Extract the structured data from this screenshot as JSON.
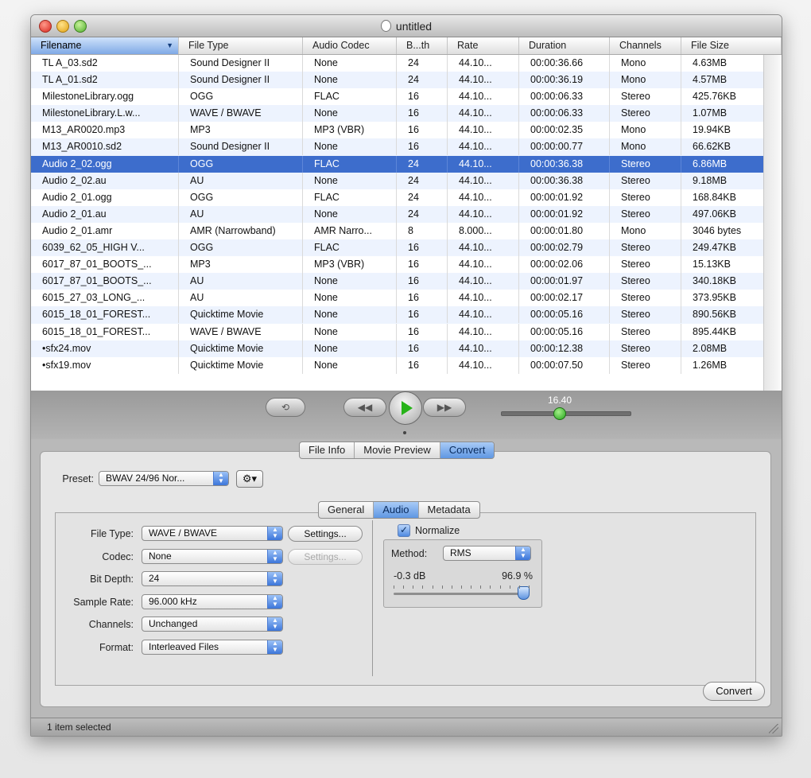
{
  "window": {
    "title": "untitled"
  },
  "table": {
    "columns": [
      "Filename",
      "File Type",
      "Audio Codec",
      "B...th",
      "Rate",
      "Duration",
      "Channels",
      "File Size"
    ],
    "rows": [
      [
        "TL A_03.sd2",
        "Sound Designer II",
        "None",
        "24",
        "44.10...",
        "00:00:36.66",
        "Mono",
        "4.63MB"
      ],
      [
        "TL A_01.sd2",
        "Sound Designer II",
        "None",
        "24",
        "44.10...",
        "00:00:36.19",
        "Mono",
        "4.57MB"
      ],
      [
        "MilestoneLibrary.ogg",
        "OGG",
        "FLAC",
        "16",
        "44.10...",
        "00:00:06.33",
        "Stereo",
        "425.76KB"
      ],
      [
        "MilestoneLibrary.L.w...",
        "WAVE / BWAVE",
        "None",
        "16",
        "44.10...",
        "00:00:06.33",
        "Stereo",
        "1.07MB"
      ],
      [
        "M13_AR0020.mp3",
        "MP3",
        "MP3 (VBR)",
        "16",
        "44.10...",
        "00:00:02.35",
        "Mono",
        "19.94KB"
      ],
      [
        "M13_AR0010.sd2",
        "Sound Designer II",
        "None",
        "16",
        "44.10...",
        "00:00:00.77",
        "Mono",
        "66.62KB"
      ],
      [
        "Audio 2_02.ogg",
        "OGG",
        "FLAC",
        "24",
        "44.10...",
        "00:00:36.38",
        "Stereo",
        "6.86MB"
      ],
      [
        "Audio 2_02.au",
        "AU",
        "None",
        "24",
        "44.10...",
        "00:00:36.38",
        "Stereo",
        "9.18MB"
      ],
      [
        "Audio 2_01.ogg",
        "OGG",
        "FLAC",
        "24",
        "44.10...",
        "00:00:01.92",
        "Stereo",
        "168.84KB"
      ],
      [
        "Audio 2_01.au",
        "AU",
        "None",
        "24",
        "44.10...",
        "00:00:01.92",
        "Stereo",
        "497.06KB"
      ],
      [
        "Audio 2_01.amr",
        "AMR (Narrowband)",
        "AMR Narro...",
        "8",
        "8.000...",
        "00:00:01.80",
        "Mono",
        "3046 bytes"
      ],
      [
        "6039_62_05_HIGH V...",
        "OGG",
        "FLAC",
        "16",
        "44.10...",
        "00:00:02.79",
        "Stereo",
        "249.47KB"
      ],
      [
        "6017_87_01_BOOTS_...",
        "MP3",
        "MP3 (VBR)",
        "16",
        "44.10...",
        "00:00:02.06",
        "Stereo",
        "15.13KB"
      ],
      [
        "6017_87_01_BOOTS_...",
        "AU",
        "None",
        "16",
        "44.10...",
        "00:00:01.97",
        "Stereo",
        "340.18KB"
      ],
      [
        "6015_27_03_LONG_...",
        "AU",
        "None",
        "16",
        "44.10...",
        "00:00:02.17",
        "Stereo",
        "373.95KB"
      ],
      [
        "6015_18_01_FOREST...",
        "Quicktime Movie",
        "None",
        "16",
        "44.10...",
        "00:00:05.16",
        "Stereo",
        "890.56KB"
      ],
      [
        "6015_18_01_FOREST...",
        "WAVE / BWAVE",
        "None",
        "16",
        "44.10...",
        "00:00:05.16",
        "Stereo",
        "895.44KB"
      ],
      [
        "•sfx24.mov",
        "Quicktime Movie",
        "None",
        "16",
        "44.10...",
        "00:00:12.38",
        "Stereo",
        "2.08MB"
      ],
      [
        "•sfx19.mov",
        "Quicktime Movie",
        "None",
        "16",
        "44.10...",
        "00:00:07.50",
        "Stereo",
        "1.26MB"
      ]
    ],
    "selected_row_index": 6,
    "sorted_column": "Filename"
  },
  "transport": {
    "loop_icon": "loop-icon",
    "rewind_icon": "rewind-icon",
    "play_icon": "play-icon",
    "fastforward_icon": "fast-forward-icon",
    "position_label": "16.40",
    "accent_green": "#28b31a"
  },
  "main_tabs": [
    "File Info",
    "Movie Preview",
    "Convert"
  ],
  "main_tabs_active": "Convert",
  "convert": {
    "preset_label": "Preset:",
    "preset_value": "BWAV 24/96 Nor...",
    "gear_icon": "gear-icon",
    "sub_tabs": [
      "General",
      "Audio",
      "Metadata"
    ],
    "sub_tabs_active": "Audio",
    "fields": {
      "file_type": {
        "label": "File Type:",
        "value": "WAVE / BWAVE"
      },
      "codec": {
        "label": "Codec:",
        "value": "None"
      },
      "bit_depth": {
        "label": "Bit Depth:",
        "value": "24"
      },
      "sample_rate": {
        "label": "Sample Rate:",
        "value": "96.000 kHz"
      },
      "channels": {
        "label": "Channels:",
        "value": "Unchanged"
      },
      "format": {
        "label": "Format:",
        "value": "Interleaved Files"
      }
    },
    "settings_label": "Settings...",
    "normalize": {
      "label": "Normalize",
      "checked": true,
      "method_label": "Method:",
      "method_value": "RMS",
      "db_value": "-0.3 dB",
      "percent_value": "96.9 %",
      "slider_level": 0.969
    },
    "convert_button": "Convert"
  },
  "status": {
    "text": "1 item selected"
  },
  "colors": {
    "selection": "#3d6dcc",
    "tab_active": "#5f97e3"
  }
}
